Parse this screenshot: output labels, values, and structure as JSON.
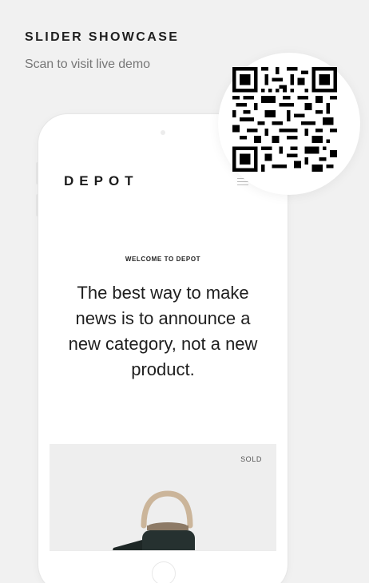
{
  "showcase": {
    "title": "SLIDER SHOWCASE",
    "subtitle": "Scan to visit live demo"
  },
  "phone_screen": {
    "brand": "DEPOT",
    "menu_icon": "hamburger-icon",
    "hero": {
      "eyebrow": "WELCOME TO DEPOT",
      "headline": "The best way to make news is to announce a new category, not a new product."
    },
    "product": {
      "badge": "SOLD",
      "image": "kettle-product-image"
    }
  },
  "qr": {
    "icon": "qr-code-icon"
  },
  "colors": {
    "background": "#f1f1f1",
    "text_primary": "#1f1f1f",
    "text_muted": "#777777",
    "product_panel": "#eeeeee"
  }
}
